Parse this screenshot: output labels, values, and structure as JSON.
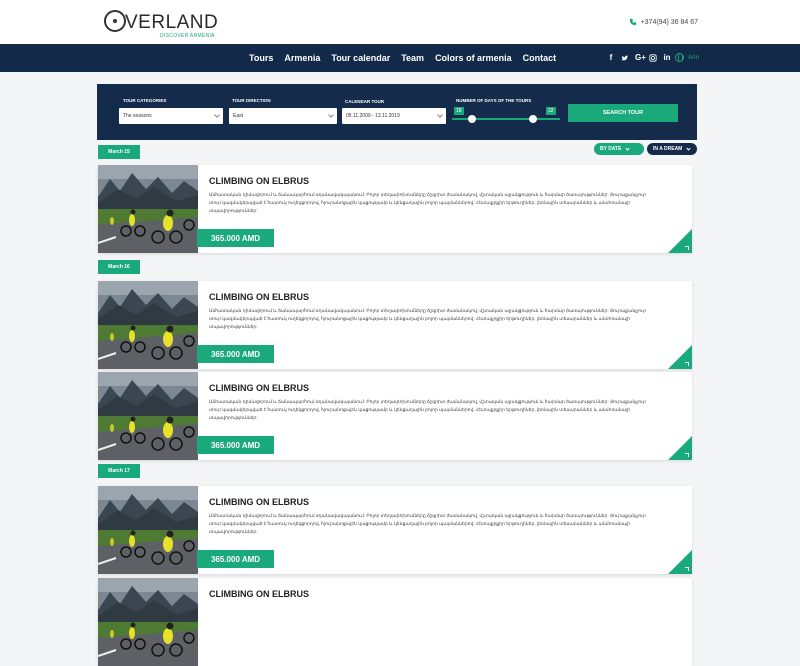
{
  "brand": {
    "name": "VERLAND",
    "tagline": "DISCOVER ARMENIA",
    "phone": "+374(94) 36 84 67"
  },
  "nav": {
    "links": [
      "Tours",
      "Armenia",
      "Tour calendar",
      "Team",
      "Colors of armenia",
      "Contact"
    ],
    "socials": [
      "f",
      "t",
      "G+",
      "ig",
      "in"
    ],
    "language": "Arm"
  },
  "filter": {
    "category_label": "TOUR CATEGORIES",
    "category_value": "The seasons",
    "direction_label": "TOUR DIRECTION",
    "direction_value": "East",
    "calendar_label": "CALENDAR TOUR",
    "calendar_value": "05.11.2009 - 13.11.2019",
    "days_label": "NUMBER OF DAYS OF THE TOURS",
    "days_min": "18",
    "days_max": "32",
    "search_label": "SEARCH TOUR"
  },
  "sort": {
    "by_date": "BY DATE",
    "dream": "IN A DREAM"
  },
  "dates": [
    "March 15",
    "March 16",
    "March 17"
  ],
  "tours": [
    {
      "title": "CLIMBING ON ELBRUS",
      "description": "Անհատական դիմավորում և ճանապարհում օդանավակայանում: Բոլոր տեղափոխումները ճշգրիտ ժամանակով, մշտական աջակցություն և հարմար ծառայություններ: Յուրաքանչյուր տուր կազմակերպված է հատուկ ուղեկցորդով, հյուրանոցային կացությամբ և կենցաղային բոլոր պայմաններով: Հետաքրքիր երթուղիներ, լեռնային տեսարաններ և անմոռանալի տպավորություններ:",
      "price": "365.000 AMD"
    },
    {
      "title": "CLIMBING ON ELBRUS",
      "description": "Անհատական դիմավորում և ճանապարհում օդանավակայանում: Բոլոր տեղափոխումները ճշգրիտ ժամանակով, մշտական աջակցություն և հարմար ծառայություններ: Յուրաքանչյուր տուր կազմակերպված է հատուկ ուղեկցորդով, հյուրանոցային կացությամբ և կենցաղային բոլոր պայմաններով: Հետաքրքիր երթուղիներ, լեռնային տեսարաններ և անմոռանալի տպավորություններ:",
      "price": "365.000 AMD"
    },
    {
      "title": "CLIMBING ON ELBRUS",
      "description": "Անհատական դիմավորում և ճանապարհում օդանավակայանում: Բոլոր տեղափոխումները ճշգրիտ ժամանակով, մշտական աջակցություն և հարմար ծառայություններ: Յուրաքանչյուր տուր կազմակերպված է հատուկ ուղեկցորդով, հյուրանոցային կացությամբ և կենցաղային բոլոր պայմաններով: Հետաքրքիր երթուղիներ, լեռնային տեսարաններ և անմոռանալի տպավորություններ:",
      "price": "365.000 AMD"
    },
    {
      "title": "CLIMBING ON ELBRUS",
      "description": "Անհատական դիմավորում և ճանապարհում օդանավակայանում: Բոլոր տեղափոխումները ճշգրիտ ժամանակով, մշտական աջակցություն և հարմար ծառայություններ: Յուրաքանչյուր տուր կազմակերպված է հատուկ ուղեկցորդով, հյուրանոցային կացությամբ և կենցաղային բոլոր պայմաններով: Հետաքրքիր երթուղիներ, լեռնային տեսարաններ և անմոռանալի տպավորություններ:",
      "price": "365.000 AMD"
    },
    {
      "title": "CLIMBING ON ELBRUS",
      "description": "",
      "price": ""
    }
  ],
  "colors": {
    "accent": "#1aa97a",
    "navy": "#13294a"
  }
}
